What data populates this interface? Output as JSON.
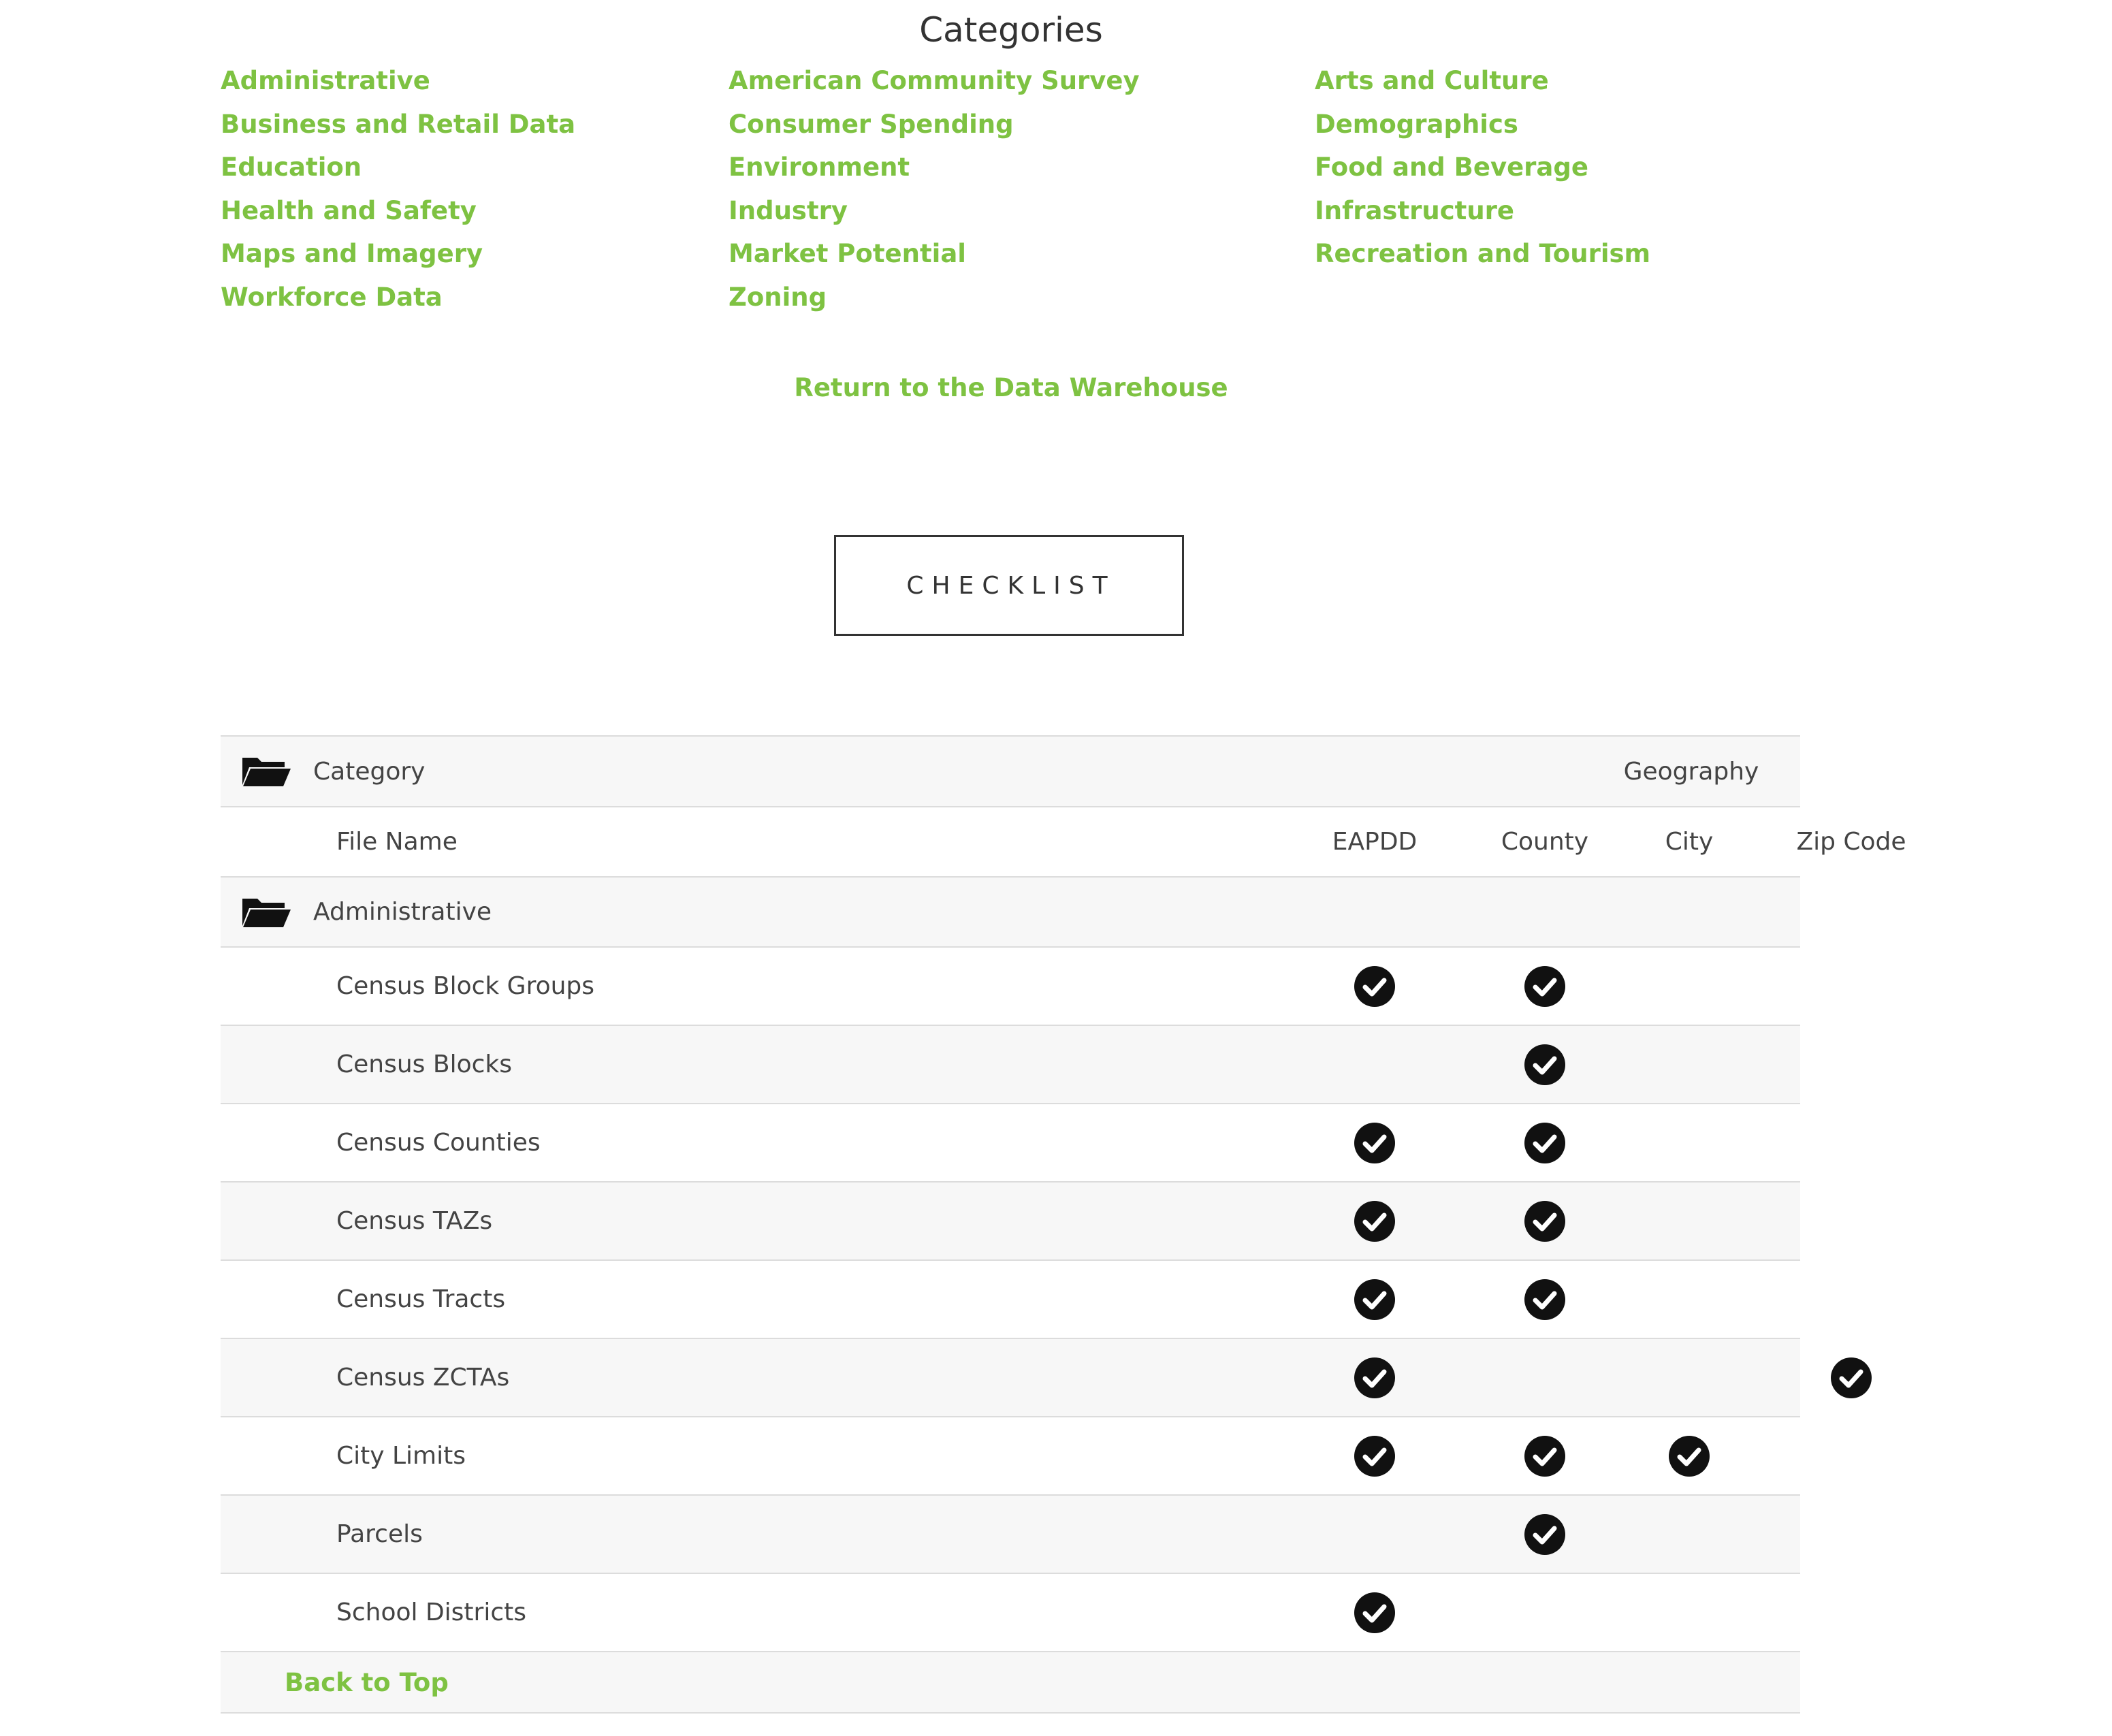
{
  "page": {
    "title": "Categories",
    "return_link": "Return to the Data Warehouse",
    "checklist_button": "CHECKLIST"
  },
  "categories": {
    "columns": [
      [
        "Administrative",
        "Business and Retail Data",
        "Education",
        "Health and Safety",
        "Maps and Imagery",
        "Workforce Data"
      ],
      [
        "American Community Survey",
        "Consumer Spending",
        "Environment",
        "Industry",
        "Market Potential",
        "Zoning"
      ],
      [
        "Arts and Culture",
        "Demographics",
        "Food and Beverage",
        "Infrastructure",
        "Recreation and Tourism"
      ]
    ]
  },
  "table": {
    "header": {
      "category_label": "Category",
      "geography_label": "Geography",
      "file_name_label": "File Name",
      "geo_columns": [
        "EAPDD",
        "County",
        "City",
        "Zip Code"
      ]
    },
    "category_row": {
      "label": "Administrative"
    },
    "rows": [
      {
        "name": "Census Block Groups",
        "eapdd": true,
        "county": true,
        "city": false,
        "zip": false
      },
      {
        "name": "Census Blocks",
        "eapdd": false,
        "county": true,
        "city": false,
        "zip": false
      },
      {
        "name": "Census Counties",
        "eapdd": true,
        "county": true,
        "city": false,
        "zip": false
      },
      {
        "name": "Census TAZs",
        "eapdd": true,
        "county": true,
        "city": false,
        "zip": false
      },
      {
        "name": "Census Tracts",
        "eapdd": true,
        "county": true,
        "city": false,
        "zip": false
      },
      {
        "name": "Census ZCTAs",
        "eapdd": true,
        "county": false,
        "city": false,
        "zip": true
      },
      {
        "name": "City Limits",
        "eapdd": true,
        "county": true,
        "city": true,
        "zip": false
      },
      {
        "name": "Parcels",
        "eapdd": false,
        "county": true,
        "city": false,
        "zip": false
      },
      {
        "name": "School Districts",
        "eapdd": true,
        "county": false,
        "city": false,
        "zip": false
      }
    ],
    "back_to_top": "Back to Top"
  },
  "colors": {
    "link_green": "#7ec242",
    "text_dark": "#333333",
    "row_shade": "#f7f7f7",
    "border": "#dcdcdc"
  },
  "icons": {
    "folder": "folder-open-icon",
    "check": "check-circle-icon"
  }
}
